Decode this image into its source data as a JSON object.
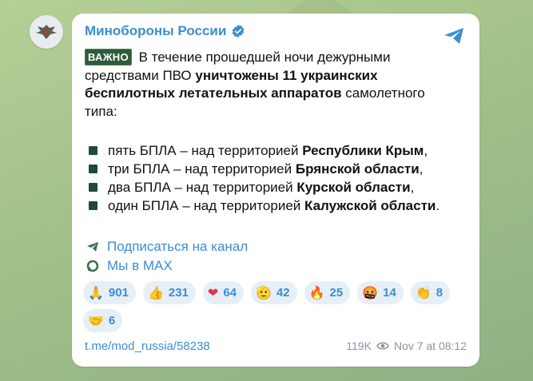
{
  "channel": {
    "name": "Минобороны России",
    "verified": true
  },
  "post": {
    "badge": "ВАЖНО",
    "text_part1": " В течение прошедшей ночи дежурными средствами ПВО ",
    "text_bold": "уничтожены 11 украинских беспилотных летательных аппаратов",
    "text_part2": " самолетного типа:",
    "items": [
      {
        "prefix": "пять БПЛА – над территорией ",
        "bold": "Республики Крым",
        "suffix": ","
      },
      {
        "prefix": "три БПЛА – над территорией ",
        "bold": "Брянской области",
        "suffix": ","
      },
      {
        "prefix": "два БПЛА – над территорией ",
        "bold": "Курской области",
        "suffix": ","
      },
      {
        "prefix": "один БПЛА – над территорией ",
        "bold": "Калужской области",
        "suffix": "."
      }
    ],
    "links": [
      {
        "icon": "telegram-icon",
        "label": "Подписаться на канал"
      },
      {
        "icon": "max-icon",
        "label": "Мы в MAX"
      }
    ]
  },
  "reactions": [
    {
      "emoji": "🙏",
      "count": "901"
    },
    {
      "emoji": "👍",
      "count": "231"
    },
    {
      "emoji": "❤",
      "count": "64"
    },
    {
      "emoji": "🫡",
      "count": "42"
    },
    {
      "emoji": "🔥",
      "count": "25"
    },
    {
      "emoji": "🤬",
      "count": "14"
    },
    {
      "emoji": "👏",
      "count": "8"
    },
    {
      "emoji": "🤝",
      "count": "6"
    }
  ],
  "footer": {
    "url": "t.me/mod_russia/58238",
    "views": "119K",
    "date": "Nov 7 at 08:12"
  },
  "colors": {
    "accent": "#3a8fd0",
    "badge_bg": "#2e5b3c",
    "bullet": "#1f4a33"
  }
}
